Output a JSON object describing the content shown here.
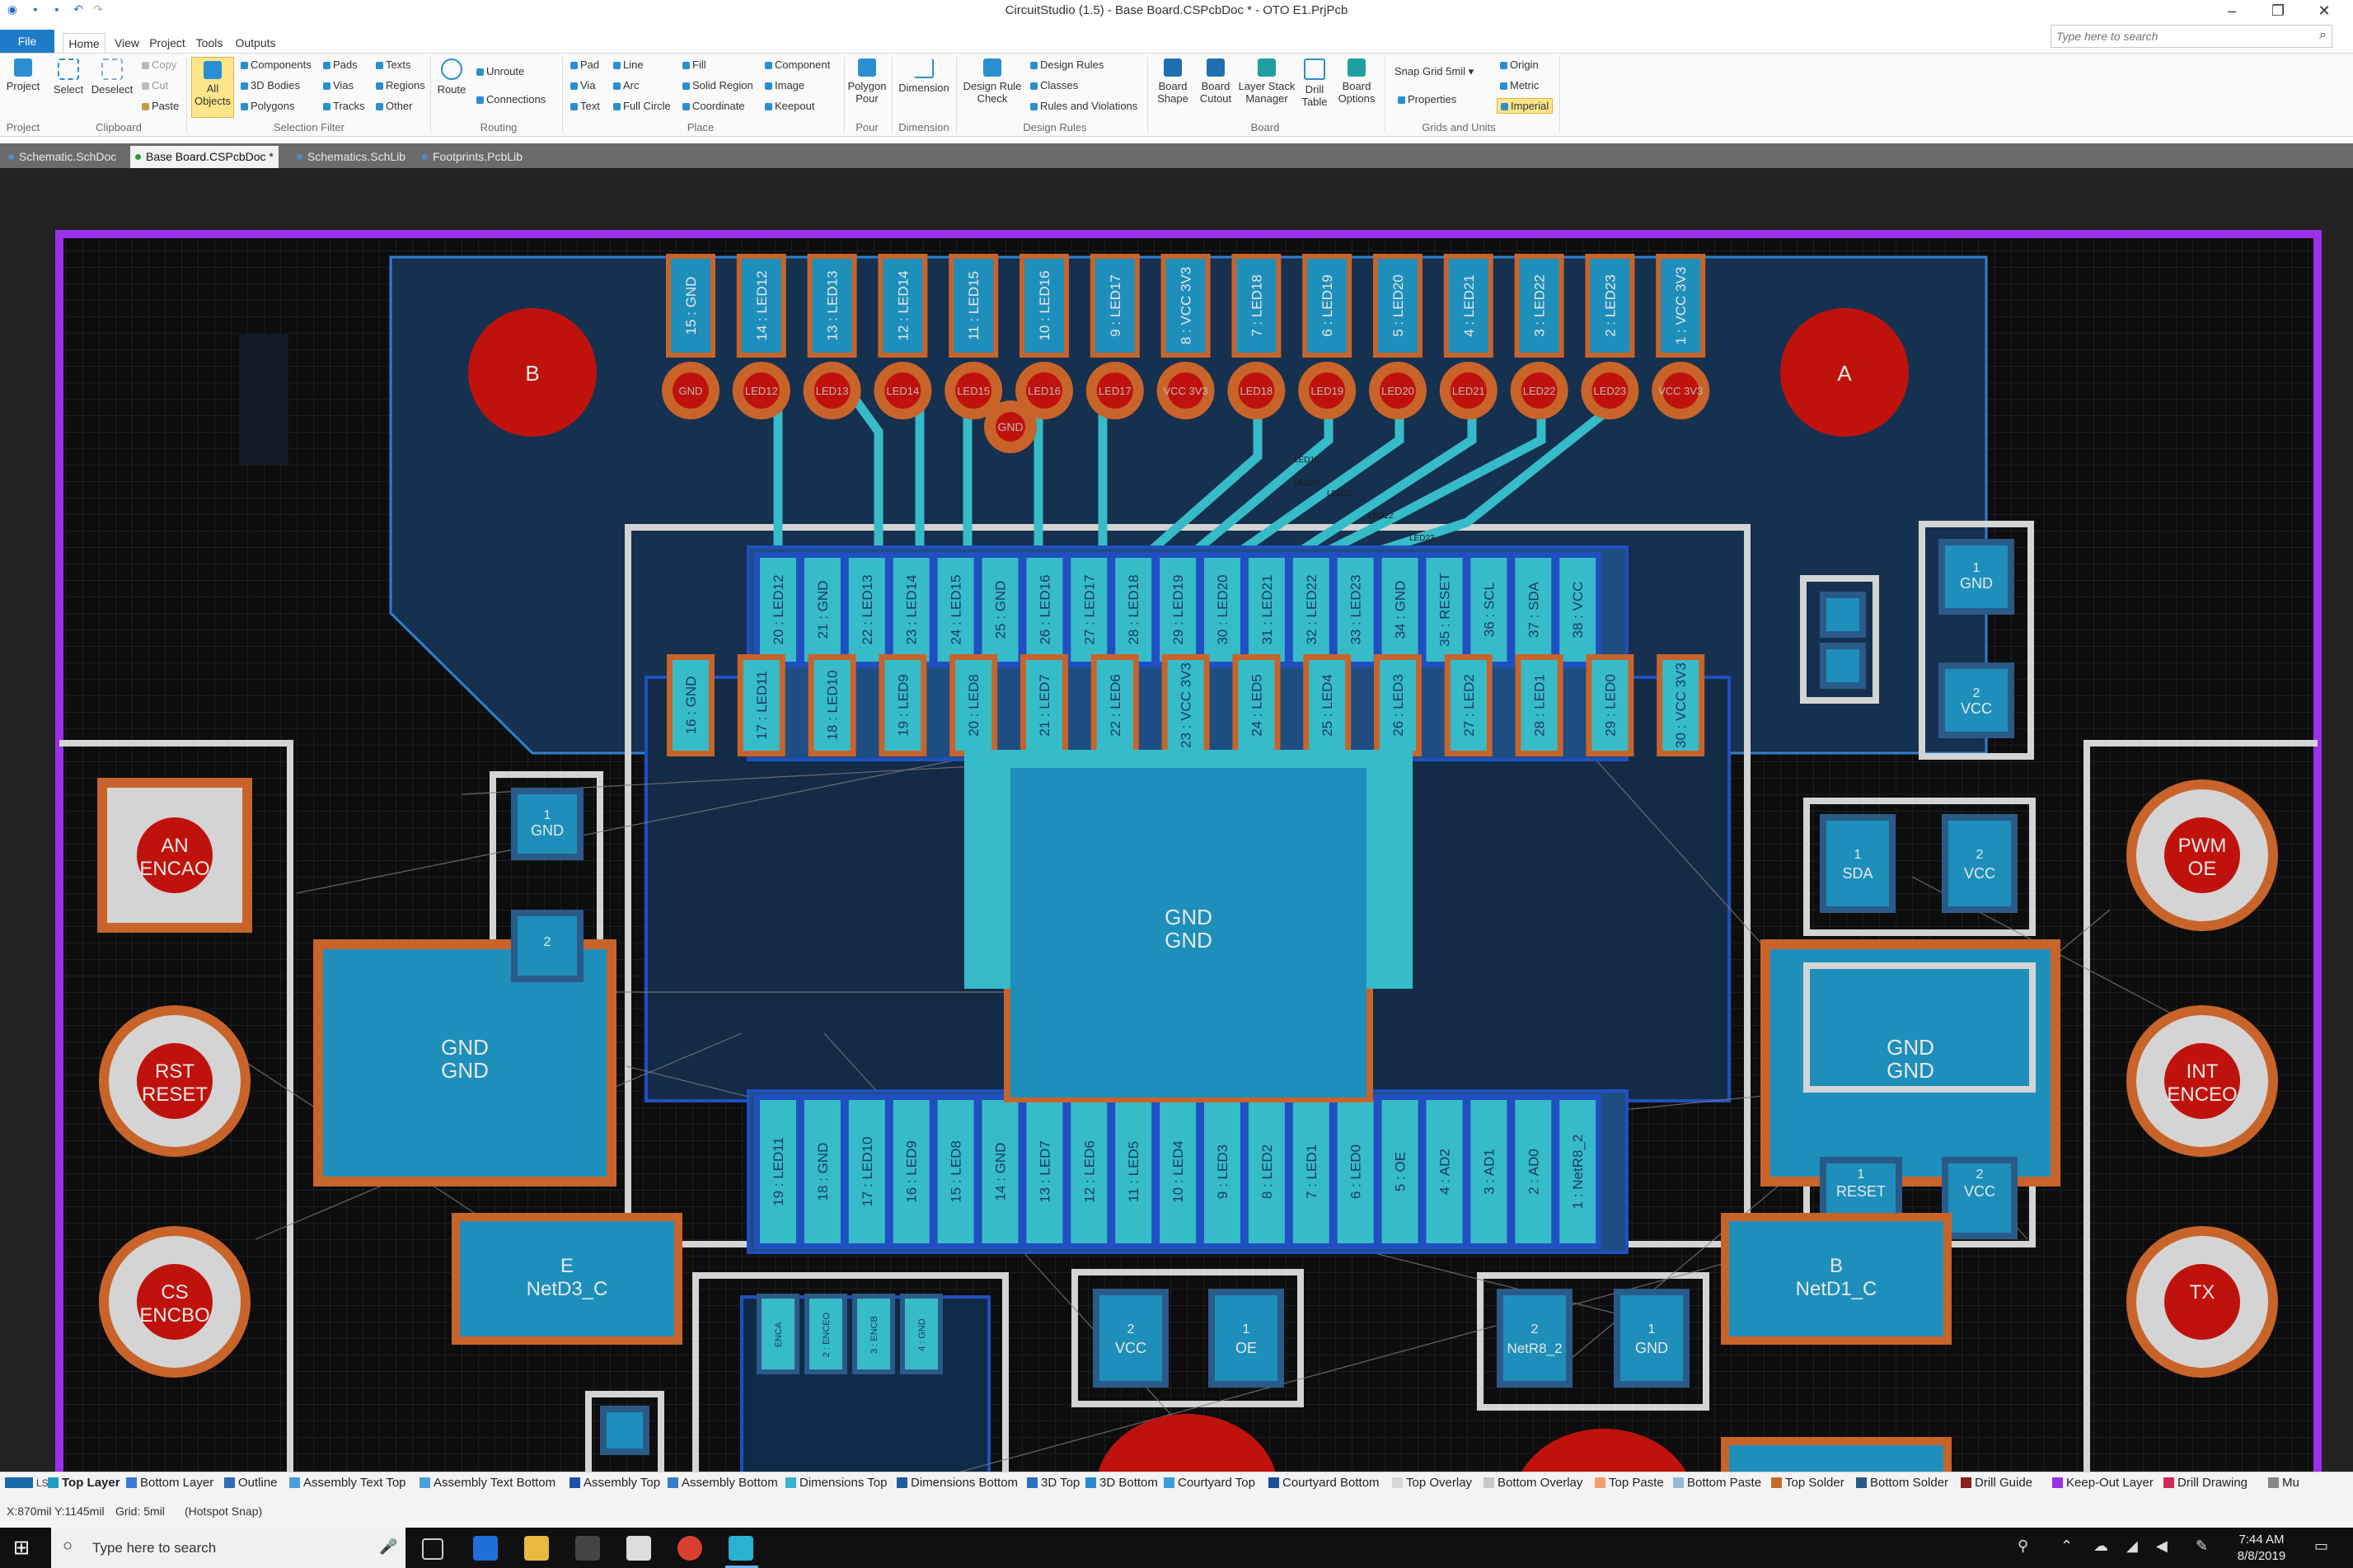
{
  "window": {
    "title": "CircuitStudio (1.5) - Base Board.CSPcbDoc * - OTO E1.PrjPcb",
    "search_placeholder": "Type here to search"
  },
  "ribbon_tabs": [
    "File",
    "Home",
    "View",
    "Project",
    "Tools",
    "Outputs"
  ],
  "ribbon": {
    "project": "Project",
    "select": "Select",
    "deselect": "Deselect",
    "copy": "Copy",
    "cut": "Cut",
    "paste": "Paste",
    "all_objects_1": "All",
    "all_objects_2": "Objects",
    "components": "Components",
    "bodies_3d": "3D Bodies",
    "polygons": "Polygons",
    "pads": "Pads",
    "vias": "Vias",
    "tracks": "Tracks",
    "texts": "Texts",
    "regions": "Regions",
    "other": "Other",
    "route": "Route",
    "unroute": "Unroute",
    "connections": "Connections",
    "pad": "Pad",
    "via": "Via",
    "text": "Text",
    "line": "Line",
    "arc": "Arc",
    "full_circle": "Full Circle",
    "fill": "Fill",
    "solid_region": "Solid Region",
    "coordinate": "Coordinate",
    "component": "Component",
    "image": "Image",
    "keepout": "Keepout",
    "polygon_pour_1": "Polygon",
    "polygon_pour_2": "Pour",
    "dimension": "Dimension",
    "drc_1": "Design Rule",
    "drc_2": "Check",
    "design_rules": "Design Rules",
    "classes": "Classes",
    "rules_violations": "Rules and Violations",
    "board_shape_1": "Board",
    "board_shape_2": "Shape",
    "board_cutout_1": "Board",
    "board_cutout_2": "Cutout",
    "layer_stack_1": "Layer Stack",
    "layer_stack_2": "Manager",
    "drill_table_1": "Drill",
    "drill_table_2": "Table",
    "board_options_1": "Board",
    "board_options_2": "Options",
    "snap_grid": "Snap Grid",
    "snap_value": "5mil",
    "properties": "Properties",
    "origin": "Origin",
    "metric": "Metric",
    "imperial": "Imperial",
    "groups": [
      "Project",
      "Clipboard",
      "Selection Filter",
      "Routing",
      "Place",
      "Pour",
      "Dimension",
      "Design Rules",
      "Board",
      "Grids and Units"
    ]
  },
  "doc_tabs": [
    "Schematic.SchDoc",
    "Base Board.CSPcbDoc *",
    "Schematics.SchLib",
    "Footprints.PcbLib"
  ],
  "pcb": {
    "mount_left": "B",
    "mount_right": "A",
    "header_pins": [
      "15 : GND",
      "14 : LED12",
      "13 : LED13",
      "12 : LED14",
      "11 : LED15",
      "10 : LED16",
      "9 : LED17",
      "8 : VCC 3V3",
      "7 : LED18",
      "6 : LED19",
      "5 : LED20",
      "4 : LED21",
      "3 : LED22",
      "2 : LED23",
      "1 : VCC 3V3"
    ],
    "header_pad_labels": [
      "GND",
      "LED12",
      "LED13",
      "LED14",
      "LED15",
      "LED16",
      "LED17",
      "VCC 3V3",
      "LED18",
      "LED19",
      "LED20",
      "LED21",
      "LED22",
      "LED23",
      "VCC 3V3"
    ],
    "via_label": "GND",
    "ic_top_row": [
      "20 : LED12",
      "21 : GND",
      "22 : LED13",
      "23 : LED14",
      "24 : LED15",
      "25 : GND",
      "26 : LED16",
      "27 : LED17",
      "28 : LED18",
      "29 : LED19",
      "30 : LED20",
      "31 : LED21",
      "32 : LED22",
      "33 : LED23",
      "34 : GND",
      "35 : RESET",
      "36 : SCL",
      "37 : SDA",
      "38 : VCC"
    ],
    "ic_second_row": [
      "16 : GND",
      "17 : LED11",
      "18 : LED10",
      "19 : LED9",
      "20 : LED8",
      "21 : LED7",
      "22 : LED6",
      "23 : VCC 3V3",
      "24 : LED5",
      "25 : LED4",
      "26 : LED3",
      "27 : LED2",
      "28 : LED1",
      "29 : LED0",
      "30 : VCC 3V3"
    ],
    "ic_bottom_row": [
      "19 : LED11",
      "18 : GND",
      "17 : LED10",
      "16 : LED9",
      "15 : LED8",
      "14 : GND",
      "13 : LED7",
      "12 : LED6",
      "11 : LED5",
      "10 : LED4",
      "9 : LED3",
      "8 : LED2",
      "7 : LED1",
      "6 : LED0",
      "5 : OE",
      "4 : AD2",
      "3 : AD1",
      "2 : AD0",
      "1 : NetR8_2"
    ],
    "thermal_pad_1": "GND",
    "thermal_pad_2": "GND",
    "left_big_pad_1": "GND",
    "left_big_pad_2": "GND",
    "right_big_pad_1": "GND",
    "right_big_pad_2": "GND",
    "cap_left_pin1_num": "1",
    "cap_left_pin1_net": "GND",
    "cap_left_pin2_num": "2",
    "cap_topright_pin1_num": "1",
    "cap_topright_pin1_net": "GND",
    "cap_topright_pin2_num": "2",
    "cap_topright_pin2_net": "VCC",
    "r_sda_num": "1",
    "r_sda_net": "SDA",
    "r_sda_vcc_num": "2",
    "r_sda_vcc_net": "VCC",
    "r_reset_num": "1",
    "r_reset_net": "RESET",
    "r_reset_vcc_num": "2",
    "r_reset_vcc_net": "VCC",
    "left_holes": [
      [
        "AN",
        "ENCAO"
      ],
      [
        "RST",
        "RESET"
      ],
      [
        "CS",
        "ENCBO"
      ]
    ],
    "right_holes": [
      [
        "PWM",
        "OE"
      ],
      [
        "INT",
        "ENCEO"
      ],
      [
        "TX",
        ""
      ]
    ],
    "pad_e_1": "E",
    "pad_e_2": "NetD3_C",
    "pad_b_1": "B",
    "pad_b_2": "NetD1_C",
    "enc_pins": [
      "ENCA",
      "2 : ENCEO",
      "3 : ENCB",
      "4 : GND"
    ],
    "cap_vcc_num": "2",
    "cap_vcc_net": "VCC",
    "cap_oe_num": "1",
    "cap_oe_net": "OE",
    "r8_num": "2",
    "r8_net": "NetR8_2",
    "r8_gnd_num": "1",
    "r8_gnd_net": "GND",
    "trace_labels": [
      "LED19",
      "LED20",
      "LED21",
      "LED22",
      "LED23"
    ]
  },
  "layers": [
    {
      "name": "LS",
      "color": "#1a6aa8"
    },
    {
      "name": "Top Layer",
      "color": "#1b9ec2"
    },
    {
      "name": "Bottom Layer",
      "color": "#3b78d8"
    },
    {
      "name": "Outline",
      "color": "#2f6db5"
    },
    {
      "name": "Assembly Text Top",
      "color": "#4aa0d8"
    },
    {
      "name": "Assembly Text Bottom",
      "color": "#4aa0d8"
    },
    {
      "name": "Assembly Top",
      "color": "#1f4fa8"
    },
    {
      "name": "Assembly Bottom",
      "color": "#3a7ec8"
    },
    {
      "name": "Dimensions Top",
      "color": "#3bb0d0"
    },
    {
      "name": "Dimensions Bottom",
      "color": "#1f5fa0"
    },
    {
      "name": "3D Top",
      "color": "#2a6fc0"
    },
    {
      "name": "3D Bottom",
      "color": "#2a8ad0"
    },
    {
      "name": "Courtyard Top",
      "color": "#3a9ed8"
    },
    {
      "name": "Courtyard Bottom",
      "color": "#1f4f98"
    },
    {
      "name": "Top Overlay",
      "color": "#d8d8d8"
    },
    {
      "name": "Bottom Overlay",
      "color": "#c8c8c8"
    },
    {
      "name": "Top Paste",
      "color": "#f2a070"
    },
    {
      "name": "Bottom Paste",
      "color": "#9ab8d8"
    },
    {
      "name": "Top Solder",
      "color": "#c66a2a"
    },
    {
      "name": "Bottom Solder",
      "color": "#2a5a88"
    },
    {
      "name": "Drill Guide",
      "color": "#8a1f1f"
    },
    {
      "name": "Keep-Out Layer",
      "color": "#9b30e8"
    },
    {
      "name": "Drill Drawing",
      "color": "#d02a5a"
    },
    {
      "name": "Mu",
      "color": "#888888"
    }
  ],
  "status": {
    "coords": "X:870mil Y:1145mil",
    "grid": "Grid: 5mil",
    "snap": "(Hotspot Snap)"
  },
  "taskbar": {
    "search": "Type here to search",
    "time": "7:44 AM",
    "date": "8/8/2019"
  },
  "colors": {
    "keepout": "#9b30e8",
    "pad_copper": "#1ea8c6",
    "solder": "#c8642a",
    "drill": "#c0120c",
    "overlay": "#d4d4d4",
    "board": "#0e0e0e"
  }
}
